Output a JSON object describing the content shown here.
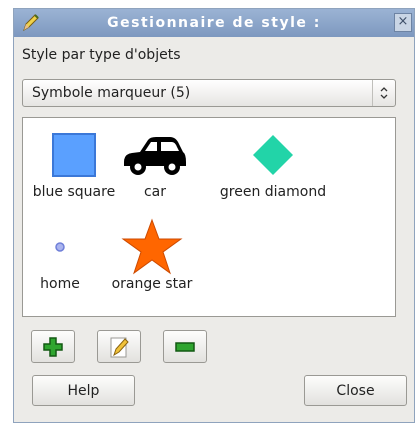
{
  "window": {
    "title": "Gestionnaire de style :",
    "close_glyph": "×"
  },
  "section": {
    "label": "Style par type d'objets"
  },
  "combo": {
    "value": "Symbole marqueur (5)"
  },
  "symbols": [
    {
      "label": "blue square",
      "icon": "blue-square",
      "color": "#5aa0ff"
    },
    {
      "label": "car",
      "icon": "car",
      "color": "#000000"
    },
    {
      "label": "green diamond",
      "icon": "green-diamond",
      "color": "#22d4a8"
    },
    {
      "label": "home",
      "icon": "small-dot",
      "color": "#6f7fd8"
    },
    {
      "label": "orange star",
      "icon": "orange-star",
      "color": "#ff6600"
    }
  ],
  "toolbar": {
    "add_icon": "add-icon",
    "edit_icon": "edit-icon",
    "remove_icon": "remove-icon"
  },
  "buttons": {
    "help": "Help",
    "close": "Close"
  }
}
